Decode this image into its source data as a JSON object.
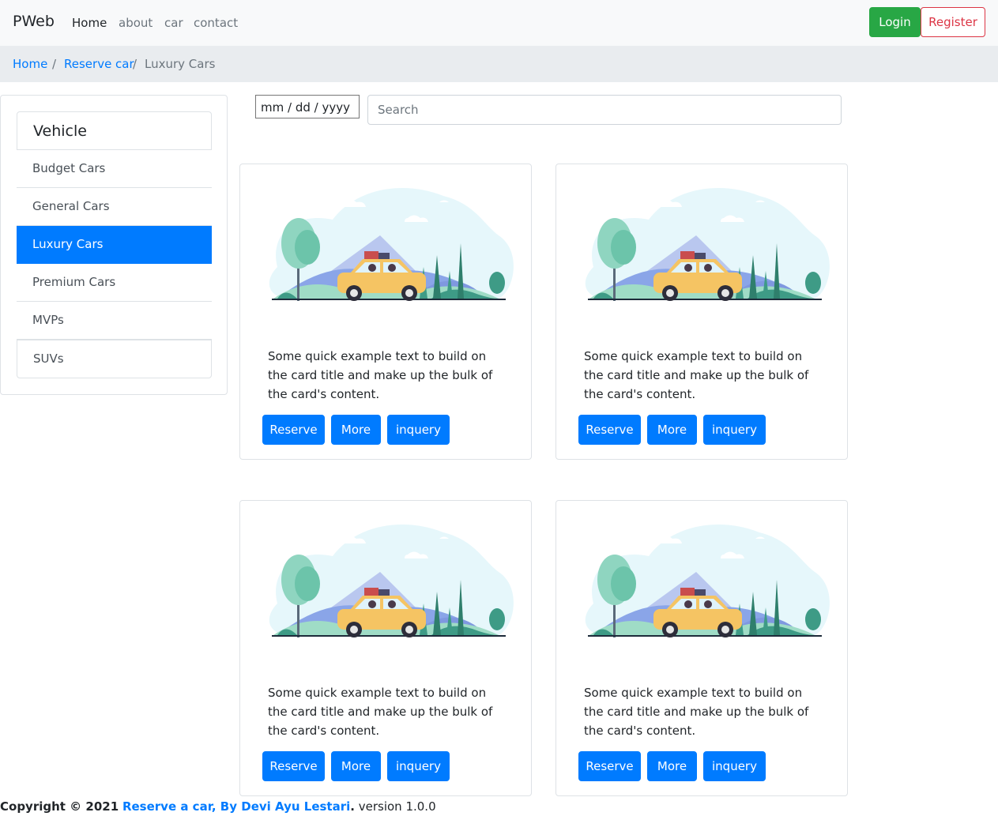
{
  "navbar": {
    "brand": "PWeb",
    "links": [
      "Home",
      "about",
      "car",
      "contact"
    ],
    "login": "Login",
    "register": "Register"
  },
  "breadcrumb": {
    "items": [
      "Home",
      "Reserve car",
      "Luxury Cars"
    ],
    "separator": "/"
  },
  "sidebar": {
    "header": "Vehicle",
    "items": [
      "Budget Cars",
      "General Cars",
      "Luxury Cars",
      "Premium Cars",
      "MVPs",
      "SUVs"
    ],
    "active_item": "Luxury Cars"
  },
  "filters": {
    "date_value": "mm / dd / yyyy",
    "search_placeholder": "Search"
  },
  "cards": [
    {
      "text": "Some quick example text to build on the card title and make up the bulk of the card's content.",
      "reserve": "Reserve",
      "more": "More",
      "inquery": "inquery"
    },
    {
      "text": "Some quick example text to build on the card title and make up the bulk of the card's content.",
      "reserve": "Reserve",
      "more": "More",
      "inquery": "inquery"
    },
    {
      "text": "Some quick example text to build on the card title and make up the bulk of the card's content.",
      "reserve": "Reserve",
      "more": "More",
      "inquery": "inquery"
    },
    {
      "text": "Some quick example text to build on the card title and make up the bulk of the card's content.",
      "reserve": "Reserve",
      "more": "More",
      "inquery": "inquery"
    }
  ],
  "footer": {
    "copyright": "Copyright © 2021",
    "link": "Reserve a car, By Devi Ayu Lestari",
    "dot": ".",
    "version": "version 1.0.0"
  },
  "colors": {
    "primary": "#007bff",
    "success": "#28a745",
    "danger": "#dc3545",
    "car": "#f5c463"
  }
}
